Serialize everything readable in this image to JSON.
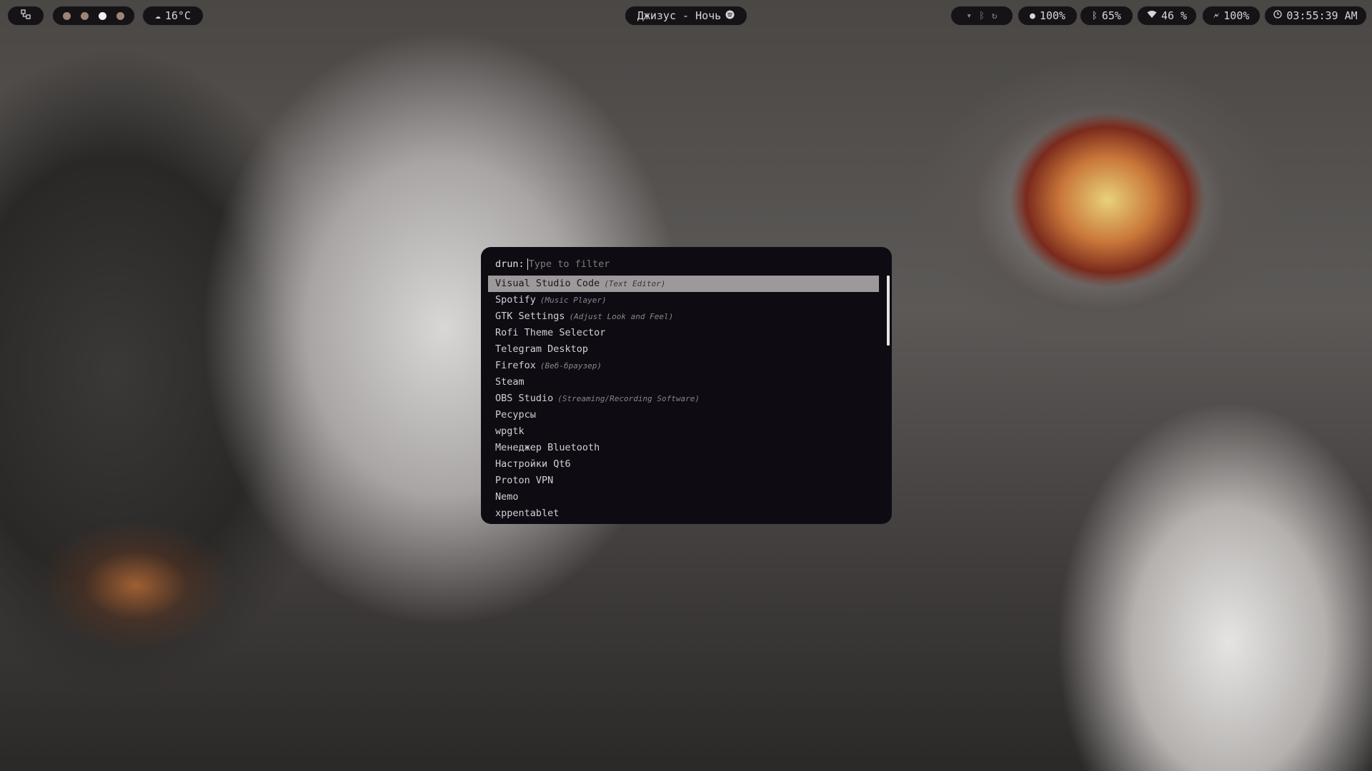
{
  "topbar": {
    "workspace_icon": "workspaces-icon",
    "workspace_dots": [
      {
        "color": "#9a8672",
        "active": false
      },
      {
        "color": "#9a8672",
        "active": false
      },
      {
        "color": "#f2f0ee",
        "active": true
      },
      {
        "color": "#9a8672",
        "active": false
      }
    ],
    "weather": {
      "icon": "cloud-icon",
      "text": "16°C"
    },
    "media": {
      "text": "Джизус - Ночь",
      "icon": "spotify-icon"
    },
    "tray": [
      "download-icon",
      "bluetooth-icon",
      "refresh-icon"
    ],
    "indicators": [
      {
        "icon": "record-icon",
        "text": "100%"
      },
      {
        "icon": "bluetooth-icon",
        "text": "65%"
      },
      {
        "icon": "wifi-icon",
        "text": "46 %"
      },
      {
        "icon": "battery-charging-icon",
        "text": "100%"
      }
    ],
    "clock": {
      "icon": "clock-icon",
      "text": "03:55:39 AM"
    }
  },
  "launcher": {
    "prompt": "drun:",
    "placeholder": "Type to filter",
    "items": [
      {
        "name": "Visual Studio Code",
        "comment": "(Text Editor)",
        "selected": true
      },
      {
        "name": "Spotify",
        "comment": "(Music Player)"
      },
      {
        "name": "GTK Settings",
        "comment": "(Adjust Look and Feel)"
      },
      {
        "name": "Rofi Theme Selector",
        "comment": ""
      },
      {
        "name": "Telegram Desktop",
        "comment": ""
      },
      {
        "name": "Firefox",
        "comment": "(Веб-браузер)"
      },
      {
        "name": "Steam",
        "comment": ""
      },
      {
        "name": "OBS Studio",
        "comment": "(Streaming/Recording Software)"
      },
      {
        "name": "Ресурсы",
        "comment": ""
      },
      {
        "name": "wpgtk",
        "comment": ""
      },
      {
        "name": "Менеджер Bluetooth",
        "comment": ""
      },
      {
        "name": "Настройки Qt6",
        "comment": ""
      },
      {
        "name": "Proton VPN",
        "comment": ""
      },
      {
        "name": "Nemo",
        "comment": ""
      },
      {
        "name": "xppentablet",
        "comment": ""
      }
    ]
  },
  "colors": {
    "bar_bg": "#161316",
    "launcher_bg": "#0f0b12",
    "selection": "#9d999b"
  }
}
